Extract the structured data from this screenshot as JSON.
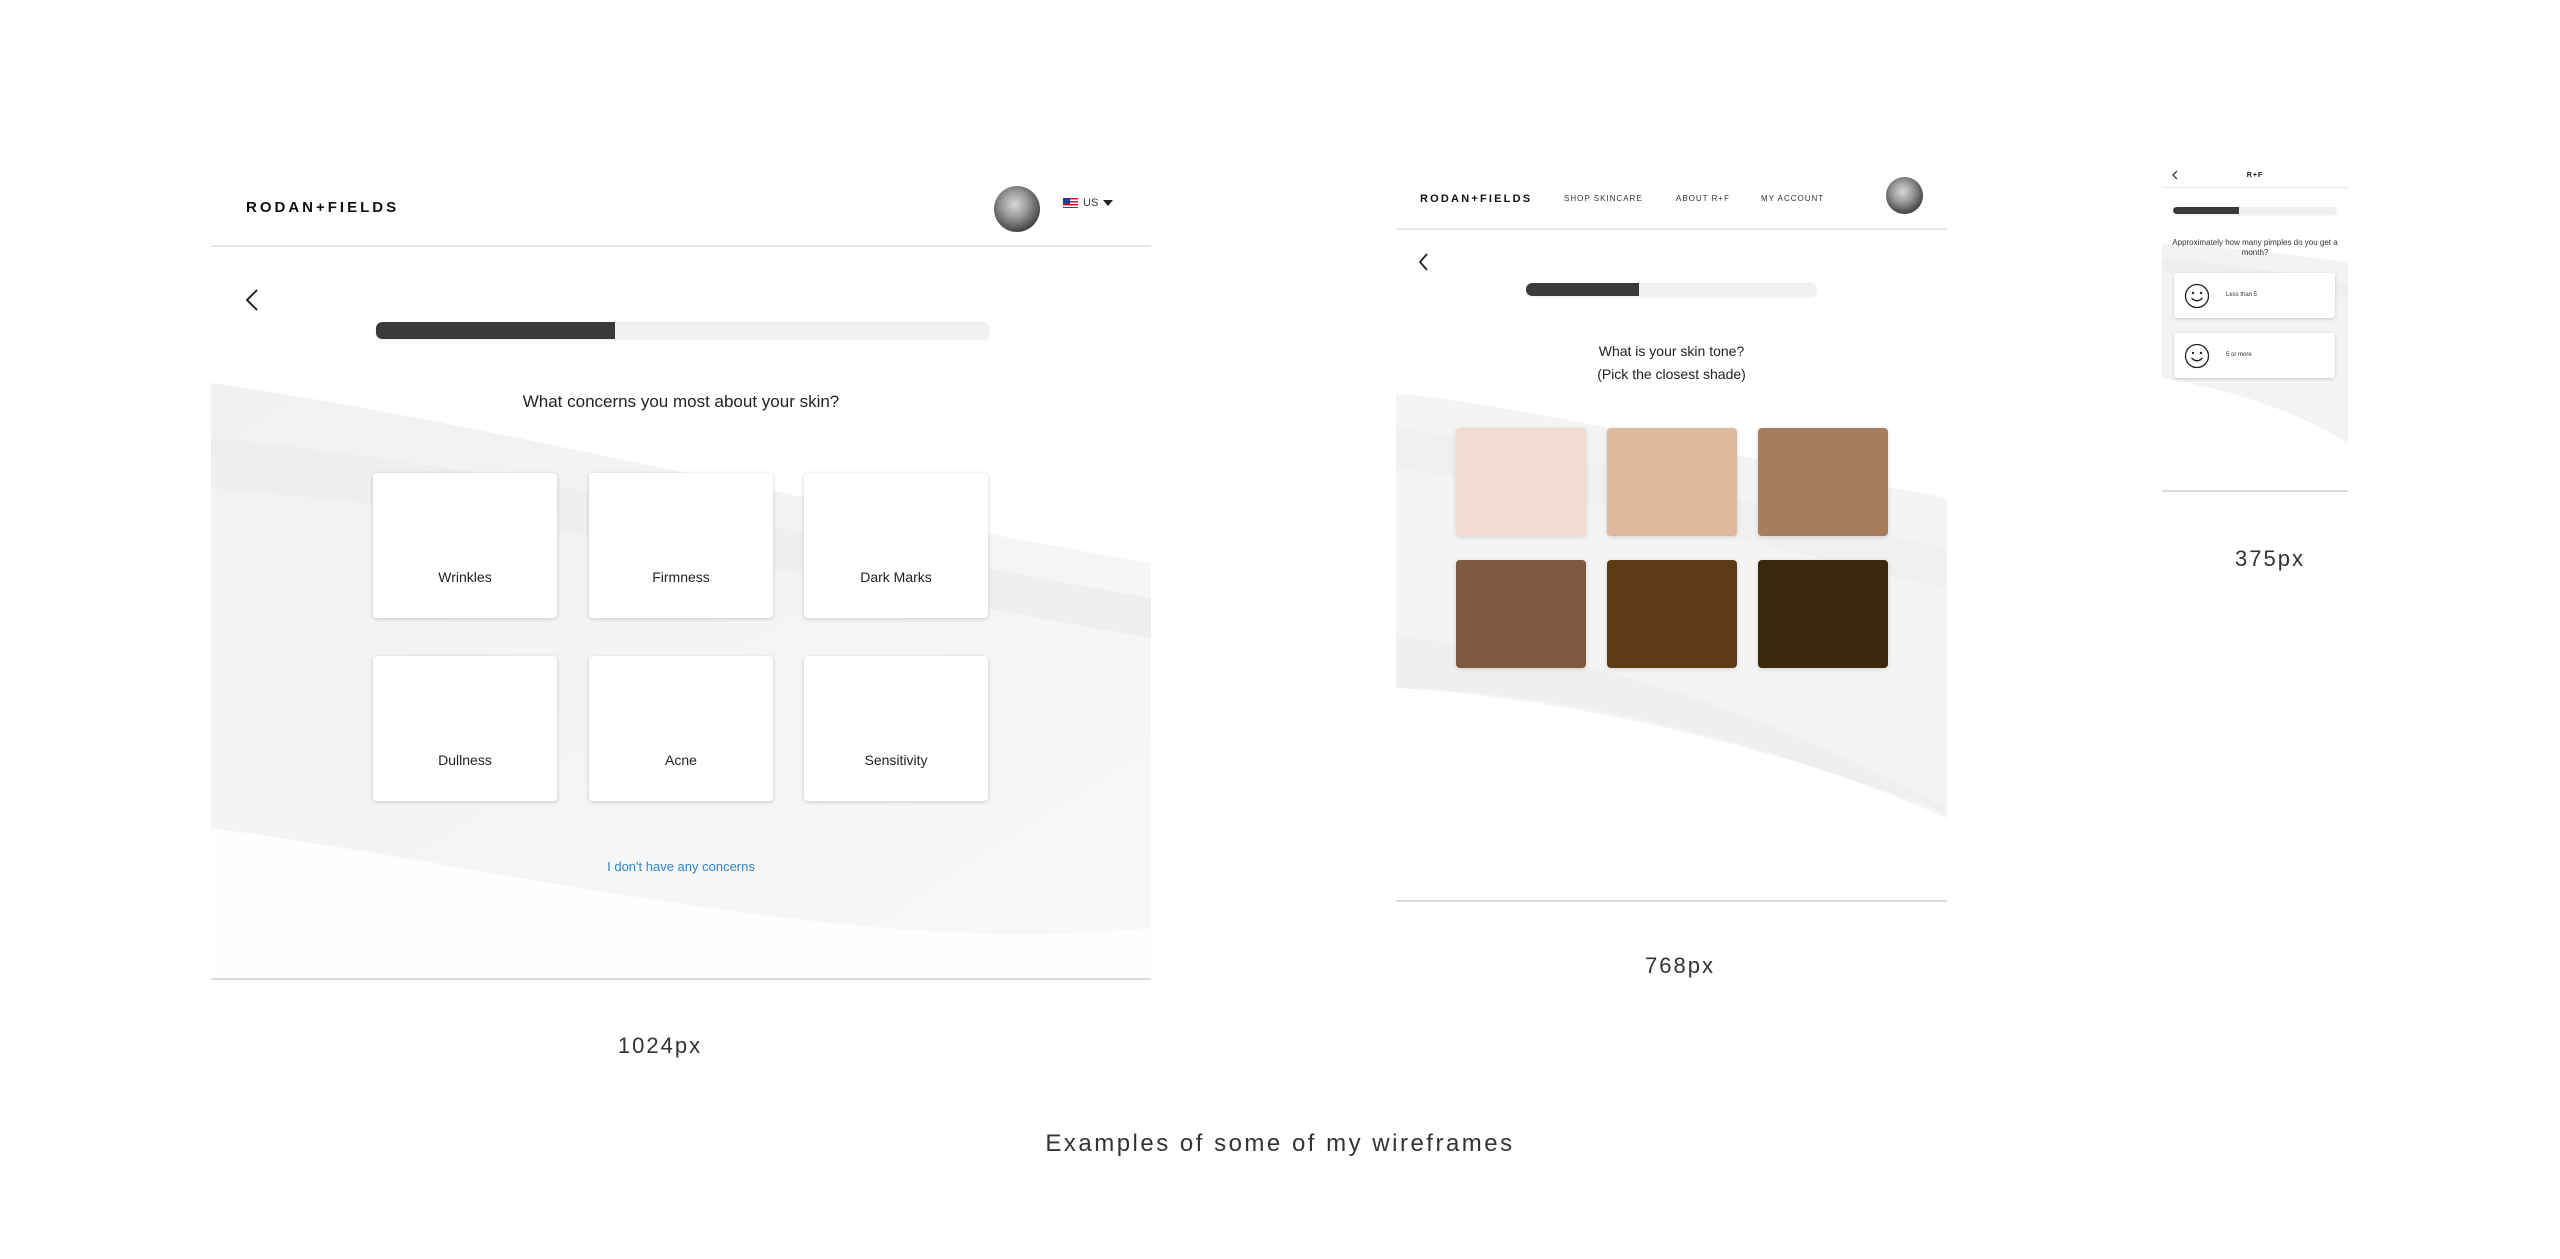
{
  "frames": {
    "desktop": {
      "logo": "RODAN+FIELDS",
      "locale": "US",
      "progress": 0.39,
      "question": "What concerns you most about your skin?",
      "options": [
        "Wrinkles",
        "Firmness",
        "Dark Marks",
        "Dullness",
        "Acne",
        "Sensitivity"
      ],
      "skip_link": "I don't have any concerns",
      "caption": "1024px"
    },
    "tablet": {
      "logo": "RODAN+FIELDS",
      "nav": [
        "SHOP SKINCARE",
        "ABOUT R+F",
        "MY ACCOUNT"
      ],
      "progress": 0.39,
      "question_line1": "What is your skin tone?",
      "question_line2": "(Pick the closest shade)",
      "swatch_colors": [
        "#f2dcd1",
        "#dfb99e",
        "#a77e5d",
        "#7d5940",
        "#5e3b17",
        "#3e270f"
      ],
      "caption": "768px"
    },
    "mobile": {
      "logo": "R+F",
      "progress": 0.4,
      "question": "Approximately how many pimples do you get a month?",
      "options": [
        "Less than 5",
        "5 or more"
      ],
      "caption": "375px"
    }
  },
  "footer": "Examples of some of my wireframes",
  "colors": {
    "accent_link": "#2f86c8",
    "progress_fill": "#3a3a3a"
  }
}
